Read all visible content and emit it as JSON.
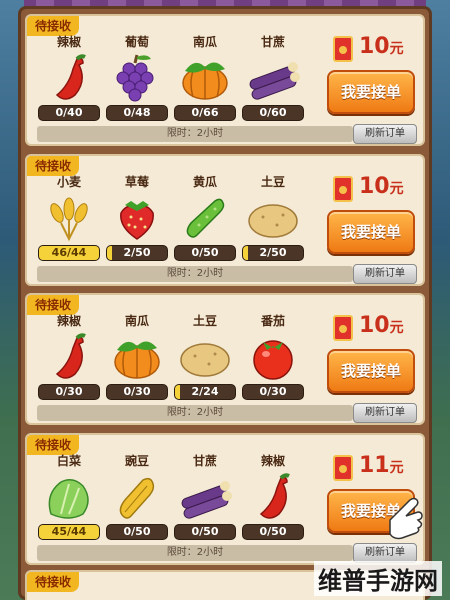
{
  "tag_label": "待接收",
  "time_limit": "限时：2小时",
  "accept_label": "我要接单",
  "refresh_label": "刷新订单",
  "currency_unit": "元",
  "orders": [
    {
      "reward": "10",
      "items": [
        {
          "name": "辣椒",
          "icon": "chili-icon",
          "progress": "0/40",
          "fraction": 0
        },
        {
          "name": "葡萄",
          "icon": "grape-icon",
          "progress": "0/48",
          "fraction": 0
        },
        {
          "name": "南瓜",
          "icon": "pumpkin-icon",
          "progress": "0/66",
          "fraction": 0
        },
        {
          "name": "甘蔗",
          "icon": "sugarcane-icon",
          "progress": "0/60",
          "fraction": 0
        }
      ]
    },
    {
      "reward": "10",
      "items": [
        {
          "name": "小麦",
          "icon": "wheat-icon",
          "progress": "46/44",
          "fraction": 1
        },
        {
          "name": "草莓",
          "icon": "strawberry-icon",
          "progress": "2/50",
          "fraction": 0.04
        },
        {
          "name": "黄瓜",
          "icon": "cucumber-icon",
          "progress": "0/50",
          "fraction": 0
        },
        {
          "name": "土豆",
          "icon": "potato-icon",
          "progress": "2/50",
          "fraction": 0.04
        }
      ]
    },
    {
      "reward": "10",
      "items": [
        {
          "name": "辣椒",
          "icon": "chili-icon",
          "progress": "0/30",
          "fraction": 0
        },
        {
          "name": "南瓜",
          "icon": "pumpkin-icon",
          "progress": "0/30",
          "fraction": 0
        },
        {
          "name": "土豆",
          "icon": "potato-icon",
          "progress": "2/24",
          "fraction": 0.083
        },
        {
          "name": "番茄",
          "icon": "tomato-icon",
          "progress": "0/30",
          "fraction": 0
        }
      ]
    },
    {
      "reward": "11",
      "items": [
        {
          "name": "白菜",
          "icon": "cabbage-icon",
          "progress": "45/44",
          "fraction": 1
        },
        {
          "name": "豌豆",
          "icon": "pea-icon",
          "progress": "0/50",
          "fraction": 0
        },
        {
          "name": "甘蔗",
          "icon": "sugarcane-icon",
          "progress": "0/50",
          "fraction": 0
        },
        {
          "name": "辣椒",
          "icon": "chili-icon",
          "progress": "0/50",
          "fraction": 0
        }
      ]
    }
  ],
  "partial_tag": "待接收",
  "watermark": "维普手游网"
}
